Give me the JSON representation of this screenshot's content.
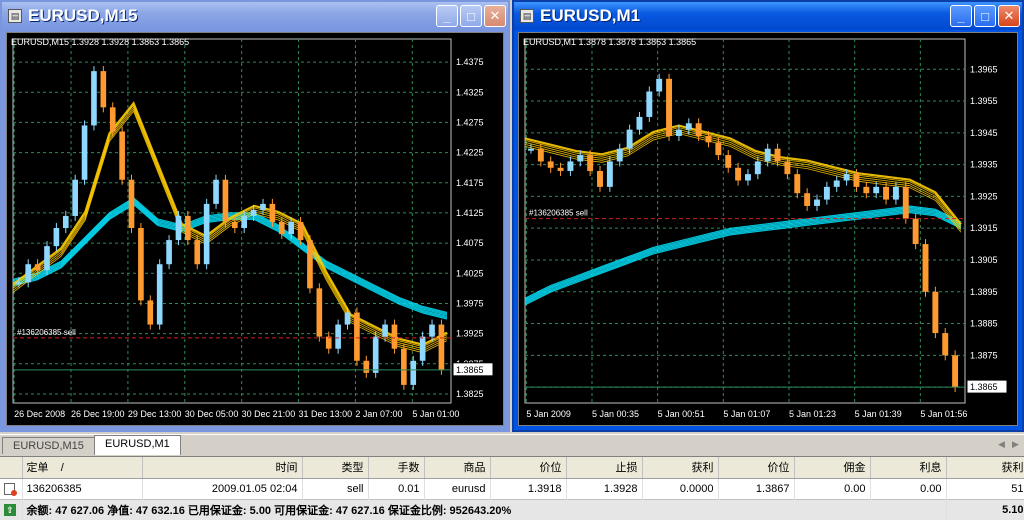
{
  "windows": [
    {
      "id": "m15",
      "title": "EURUSD,M15",
      "header": "EURUSD,M15  1.3928 1.3928 1.3863 1.3865",
      "order_label": "#136206385 sell",
      "price_box": "1.3865",
      "y_ticks": [
        "1.4375",
        "1.4325",
        "1.4275",
        "1.4225",
        "1.4175",
        "1.4125",
        "1.4075",
        "1.4025",
        "1.3975",
        "1.3925",
        "1.3875",
        "1.3825"
      ],
      "x_ticks": [
        "26 Dec 2008",
        "26 Dec 19:00",
        "29 Dec 13:00",
        "30 Dec 05:00",
        "30 Dec 21:00",
        "31 Dec 13:00",
        "2 Jan 07:00",
        "5 Jan 01:00"
      ],
      "ylim": [
        1.381,
        1.44
      ],
      "order_price": 1.3918,
      "last_price": 1.3865,
      "ma_fast": [
        1.4,
        1.403,
        1.406,
        1.412,
        1.425,
        1.43,
        1.42,
        1.41,
        1.408,
        1.411,
        1.413,
        1.412,
        1.41,
        1.402,
        1.395,
        1.393,
        1.391,
        1.39,
        1.392
      ],
      "ma_slow": [
        1.401,
        1.402,
        1.404,
        1.408,
        1.412,
        1.4145,
        1.411,
        1.41,
        1.4115,
        1.412,
        1.412,
        1.41,
        1.407,
        1.404,
        1.402,
        1.4,
        1.398,
        1.3965,
        1.3955
      ],
      "candles": [
        1.401,
        1.404,
        1.403,
        1.407,
        1.41,
        1.412,
        1.418,
        1.427,
        1.436,
        1.43,
        1.426,
        1.418,
        1.41,
        1.398,
        1.394,
        1.404,
        1.408,
        1.412,
        1.408,
        1.404,
        1.414,
        1.418,
        1.411,
        1.41,
        1.412,
        1.413,
        1.414,
        1.411,
        1.409,
        1.411,
        1.408,
        1.4,
        1.392,
        1.39,
        1.394,
        1.396,
        1.388,
        1.386,
        1.392,
        1.394,
        1.39,
        1.384,
        1.388,
        1.392,
        1.394,
        1.3865
      ]
    },
    {
      "id": "m1",
      "title": "EURUSD,M1",
      "header": "EURUSD,M1  1.3878 1.3878 1.3863 1.3865",
      "order_label": "#136206385 sell",
      "price_box": "1.3865",
      "y_ticks": [
        "1.3965",
        "1.3955",
        "1.3945",
        "1.3935",
        "1.3925",
        "1.3915",
        "1.3905",
        "1.3895",
        "1.3885",
        "1.3875",
        "1.3865"
      ],
      "x_ticks": [
        "5 Jan 2009",
        "5 Jan 00:35",
        "5 Jan 00:51",
        "5 Jan 01:07",
        "5 Jan 01:23",
        "5 Jan 01:39",
        "5 Jan 01:56"
      ],
      "ylim": [
        1.386,
        1.3972
      ],
      "order_price": 1.3918,
      "last_price": 1.3865,
      "ma_fast": [
        1.3942,
        1.394,
        1.3938,
        1.3937,
        1.3939,
        1.3944,
        1.3946,
        1.3944,
        1.3942,
        1.3938,
        1.3936,
        1.3935,
        1.3933,
        1.3931,
        1.393,
        1.3929,
        1.3925,
        1.3915
      ],
      "ma_slow": [
        1.3892,
        1.3896,
        1.3899,
        1.3902,
        1.3905,
        1.3908,
        1.391,
        1.3912,
        1.3914,
        1.3915,
        1.3916,
        1.3917,
        1.3918,
        1.3919,
        1.392,
        1.3921,
        1.392,
        1.3916
      ],
      "candles": [
        1.394,
        1.3936,
        1.3934,
        1.3933,
        1.3936,
        1.3938,
        1.3933,
        1.3928,
        1.3936,
        1.394,
        1.3946,
        1.395,
        1.3958,
        1.3962,
        1.3944,
        1.3946,
        1.3948,
        1.3944,
        1.3942,
        1.3938,
        1.3934,
        1.393,
        1.3932,
        1.3936,
        1.394,
        1.3936,
        1.3932,
        1.3926,
        1.3922,
        1.3924,
        1.3928,
        1.393,
        1.3932,
        1.3928,
        1.3926,
        1.3928,
        1.3924,
        1.3928,
        1.3918,
        1.391,
        1.3895,
        1.3882,
        1.3875,
        1.3865
      ]
    }
  ],
  "tabs": [
    "EURUSD,M15",
    "EURUSD,M1"
  ],
  "active_tab": 1,
  "table": {
    "headers": [
      "定单",
      "/",
      "时间",
      "类型",
      "手数",
      "商品",
      "价位",
      "止损",
      "获利",
      "价位",
      "佣金",
      "利息",
      "获利"
    ],
    "row": [
      "136206385",
      "2009.01.05 02:04",
      "sell",
      "0.01",
      "eurusd",
      "1.3918",
      "1.3928",
      "0.0000",
      "1.3867",
      "0.00",
      "0.00",
      "51"
    ],
    "summary": "余额: 47 627.06  净值: 47 632.16  已用保证金: 5.00  可用保证金: 47 627.16  保证金比例: 952643.20%",
    "summary_right": "5.10"
  },
  "colors": {
    "grid": "#2e8b57",
    "ma_slow": "#00e5ff",
    "ma_fast": "#ffcc00",
    "bull": "#8fd8ff",
    "bear": "#ff9a30",
    "order": "#d02020",
    "last": "#2e8b57"
  }
}
